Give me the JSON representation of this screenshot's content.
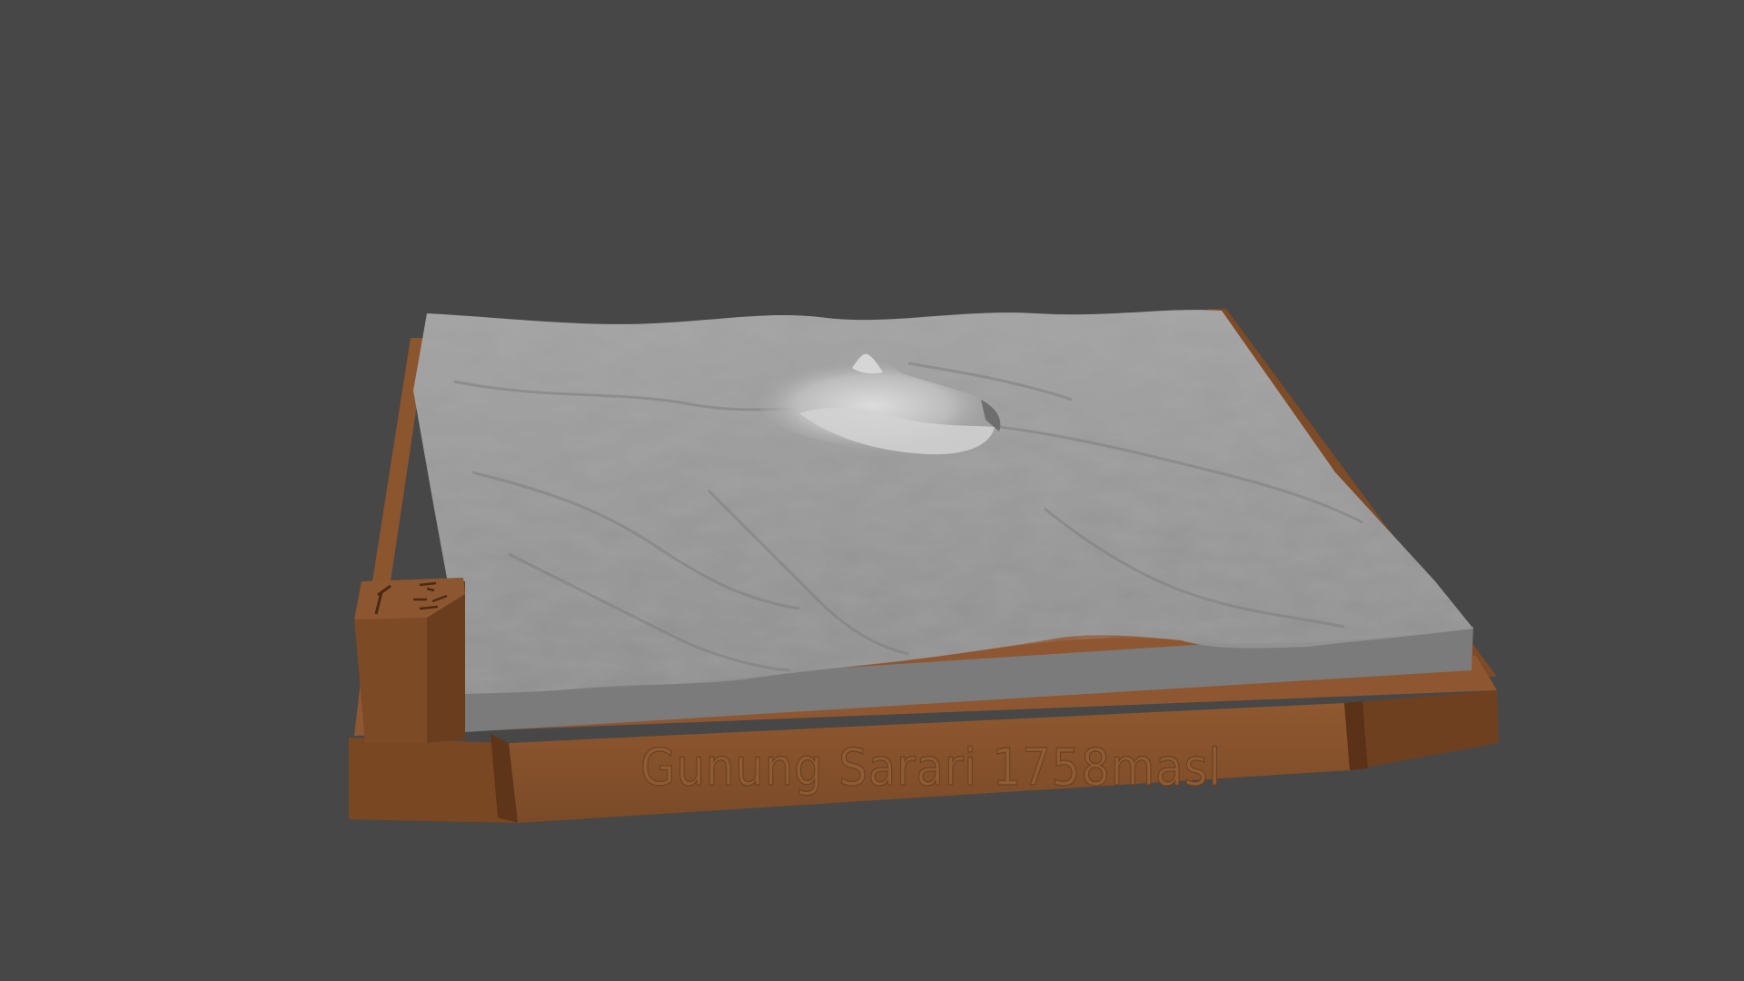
{
  "viewport": {
    "background_color": "#474747"
  },
  "model": {
    "base_color": "#8b552e",
    "base_shadow_color": "#6a3f1f",
    "terrain_color": "#9a9a9a",
    "terrain_highlight_color": "#c9c9c9",
    "terrain_wall_color": "#777777"
  },
  "label": {
    "text": "Gunung Sarari 1758masl"
  },
  "icons": [
    "hammer-icon",
    "legend-marks-icon"
  ]
}
